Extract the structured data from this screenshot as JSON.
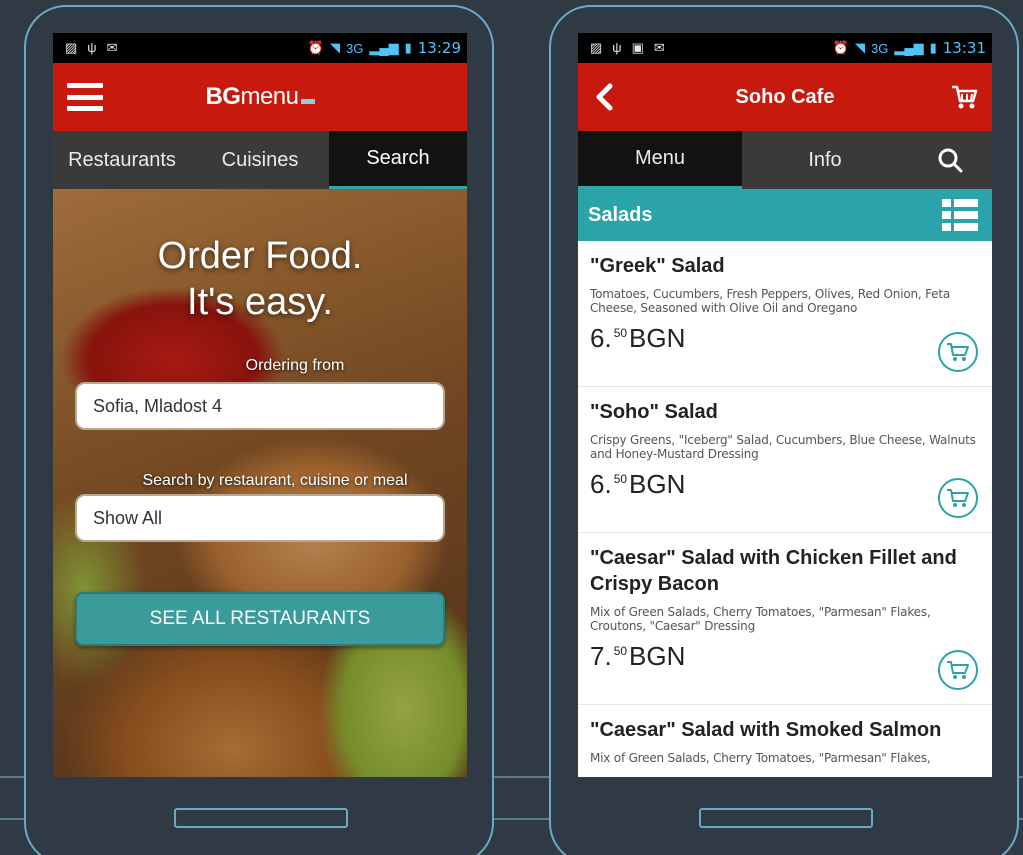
{
  "colors": {
    "background": "#2f3a44",
    "frame": "#6aa9c4",
    "header_red": "#c8190f",
    "accent_teal": "#2aa4a8",
    "tab_dark": "#3a3a3a"
  },
  "left_phone": {
    "status": {
      "time": "13:29",
      "network": "3G"
    },
    "logo": {
      "bold": "BG",
      "light": "menu"
    },
    "tabs": [
      {
        "label": "Restaurants"
      },
      {
        "label": "Cuisines"
      },
      {
        "label": "Search"
      }
    ],
    "hero": {
      "title_line1": "Order Food.",
      "title_line2": "It's easy.",
      "ordering_label": "Ordering from",
      "location_value": "Sofia, Mladost 4",
      "search_label": "Search by restaurant, cuisine or meal",
      "search_value": "Show All",
      "cta": "SEE ALL RESTAURANTS"
    }
  },
  "right_phone": {
    "status": {
      "time": "13:31",
      "network": "3G"
    },
    "header_title": "Soho Cafe",
    "tabs": [
      {
        "label": "Menu"
      },
      {
        "label": "Info"
      }
    ],
    "section_title": "Salads",
    "items": [
      {
        "title": "\"Greek\" Salad",
        "desc": "Tomatoes, Cucumbers, Fresh Peppers, Olives, Red Onion, Feta Cheese, Seasoned with Olive Oil and Oregano",
        "price_int": "6.",
        "price_dec": "50",
        "currency": "BGN"
      },
      {
        "title": "\"Soho\" Salad",
        "desc": "Crispy Greens, \"Iceberg\" Salad, Cucumbers, Blue Cheese, Walnuts and Honey-Mustard Dressing",
        "price_int": "6.",
        "price_dec": "50",
        "currency": "BGN"
      },
      {
        "title": "\"Caesar\" Salad with Chicken Fillet and Crispy Bacon",
        "desc": "Mix of Green Salads, Cherry Tomatoes, \"Parmesan\" Flakes, Croutons, \"Caesar\" Dressing",
        "price_int": "7.",
        "price_dec": "50",
        "currency": "BGN"
      },
      {
        "title": "\"Caesar\" Salad with Smoked Salmon",
        "desc": "Mix of Green Salads, Cherry Tomatoes, \"Parmesan\" Flakes,"
      }
    ]
  }
}
